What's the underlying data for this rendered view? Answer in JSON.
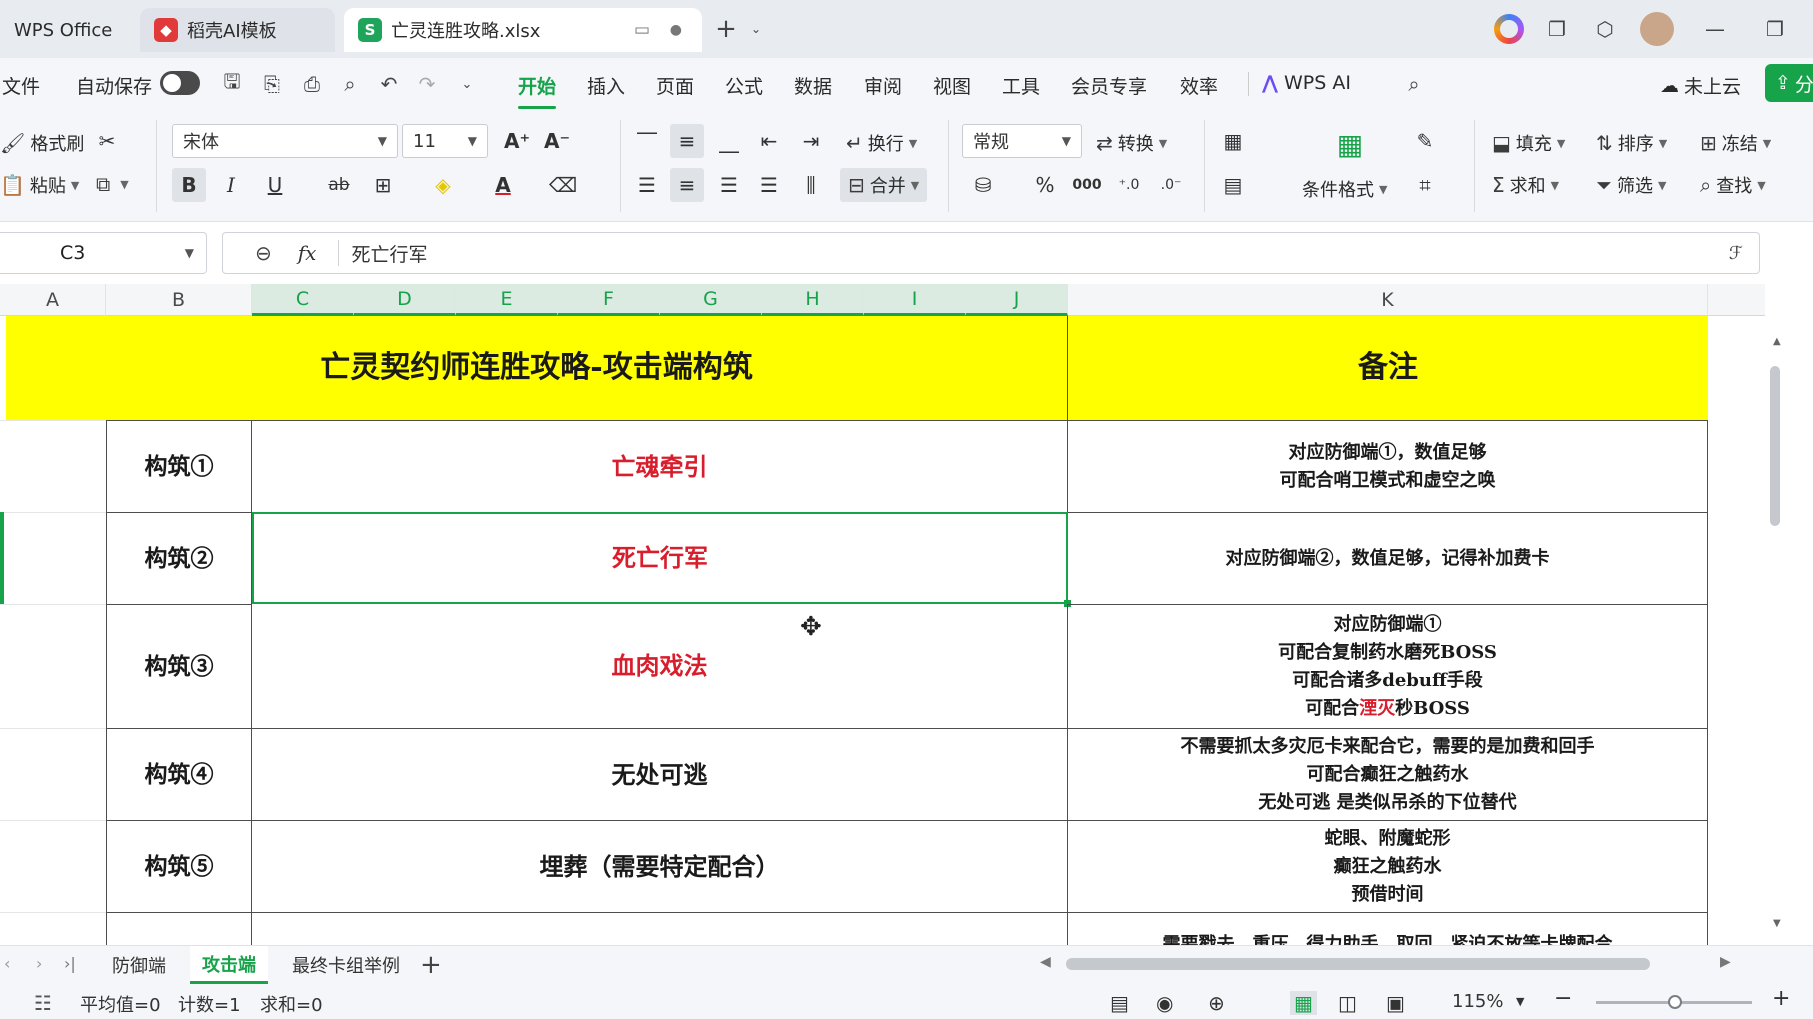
{
  "tabs": [
    {
      "label": "WPS Office",
      "icon": "wps-logo-icon",
      "active": false
    },
    {
      "label": "稻壳AI模板",
      "icon": "docer-icon",
      "active": false
    },
    {
      "label": "亡灵连胜攻略.xlsx",
      "icon": "spreadsheet-s-icon",
      "icon_text": "S",
      "active": true
    }
  ],
  "menu": {
    "file": "文件",
    "autosave": "自动保存",
    "items": [
      "开始",
      "插入",
      "页面",
      "公式",
      "数据",
      "审阅",
      "视图",
      "工具",
      "会员专享",
      "效率"
    ],
    "active": "开始",
    "wps_ai": "WPS AI",
    "cloud": "未上云",
    "share": "分"
  },
  "ribbon": {
    "format_painter": "格式刷",
    "paste": "粘贴",
    "font_name": "宋体",
    "font_size": "11",
    "wrap": "换行",
    "merge": "合并",
    "number_format": "常规",
    "convert": "转换",
    "conditional_format": "条件格式",
    "fill": "填充",
    "sort": "排序",
    "freeze": "冻结",
    "sum": "求和",
    "filter": "筛选",
    "find": "查找",
    "bold": "B",
    "italic": "I",
    "underline": "U",
    "strike": "ab",
    "percent": "%",
    "thousands": "000"
  },
  "formula_bar": {
    "cell_ref": "C3",
    "fx": "fx",
    "content": "死亡行军"
  },
  "columns": [
    "A",
    "B",
    "C",
    "D",
    "E",
    "F",
    "G",
    "H",
    "I",
    "J",
    "K"
  ],
  "selected_columns": [
    "C",
    "D",
    "E",
    "F",
    "G",
    "H",
    "I",
    "J"
  ],
  "sheet": {
    "title": "亡灵契约师连胜攻略-攻击端构筑",
    "note_header": "备注",
    "rows": [
      {
        "label": "构筑①",
        "build": "亡魂牵引",
        "build_color": "#d81e2c",
        "notes": [
          "对应防御端①，数值足够",
          "可配合哨卫模式和虚空之唤"
        ]
      },
      {
        "label": "构筑②",
        "build": "死亡行军",
        "build_color": "#d81e2c",
        "notes": [
          "对应防御端②，数值足够，记得补加费卡"
        ]
      },
      {
        "label": "构筑③",
        "build": "血肉戏法",
        "build_color": "#d81e2c",
        "notes": [
          "对应防御端①",
          "可配合复制药水磨死BOSS",
          "可配合诸多debuff手段",
          "可配合湮灭秒BOSS"
        ]
      },
      {
        "label": "构筑④",
        "build": "无处可逃",
        "build_color": "#1a1a1a",
        "notes": [
          "不需要抓太多灾厄卡来配合它，需要的是加费和回手",
          "可配合癫狂之触药水",
          "无处可逃 是类似吊杀的下位替代"
        ]
      },
      {
        "label": "构筑⑤",
        "build": "埋葬（需要特定配合）",
        "build_color": "#1a1a1a",
        "notes": [
          "蛇眼、附魔蛇形",
          "癫狂之触药水",
          "预借时间"
        ]
      },
      {
        "label": "",
        "build": "",
        "build_color": "#1a1a1a",
        "notes": [
          "需要戳去、重压、得力助手、取回、紧迫不放等卡牌配合"
        ]
      }
    ],
    "row3_note4_prefix": "可配合",
    "row3_note4_red": "湮灭",
    "row3_note4_suffix": "秒BOSS"
  },
  "sheet_tabs": [
    "防御端",
    "攻击端",
    "最终卡组举例"
  ],
  "active_sheet": "攻击端",
  "status": {
    "average": "平均值=0",
    "count": "计数=1",
    "sum": "求和=0",
    "zoom": "115%"
  },
  "colors": {
    "accent": "#16a34a",
    "title_fill": "#ffff00",
    "red_text": "#d81e2c"
  }
}
